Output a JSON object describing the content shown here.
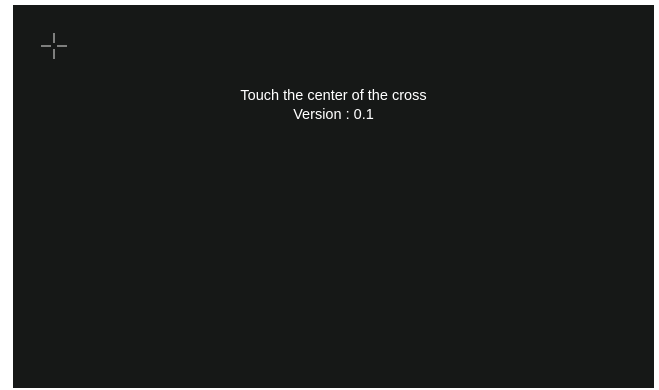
{
  "screen": {
    "background_color": "#161817",
    "text_color": "#ffffff"
  },
  "calibration": {
    "target_icon": "crosshair-icon",
    "instruction": "Touch the center of the cross",
    "version": "Version : 0.1"
  }
}
